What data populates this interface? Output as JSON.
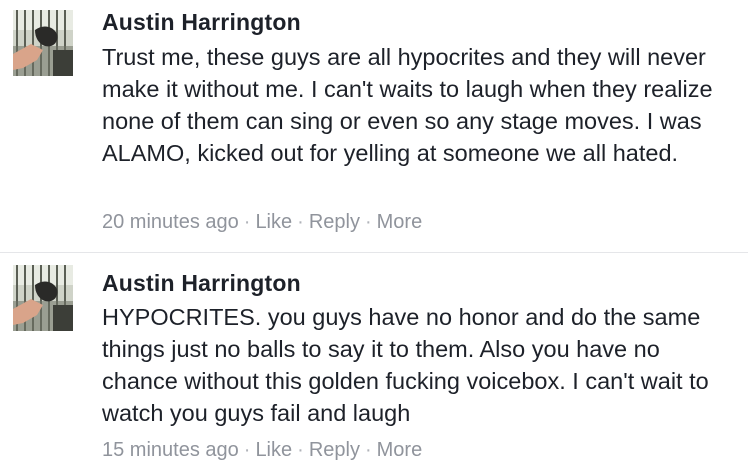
{
  "comments": [
    {
      "author": "Austin Harrington",
      "text": "Trust me, these guys are all hypocrites and they will never make it without me. I can't waits to laugh when they realize none of them can sing or even so any stage moves. I was ALAMO, kicked out for yelling at someone we all hated.",
      "time": "20 minutes ago",
      "like_label": "Like",
      "reply_label": "Reply",
      "more_label": "More",
      "separator": "·"
    },
    {
      "author": "Austin Harrington",
      "text": "HYPOCRITES. you guys have no honor and do the same things just no balls to say it to them. Also you have no chance without this golden fucking voicebox. I can't wait to watch you guys fail and laugh",
      "time": "15 minutes ago",
      "like_label": "Like",
      "reply_label": "Reply",
      "more_label": "More",
      "separator": "·"
    }
  ],
  "colors": {
    "text": "#1d2129",
    "meta": "#90949c",
    "divider": "#e5e6e9"
  }
}
